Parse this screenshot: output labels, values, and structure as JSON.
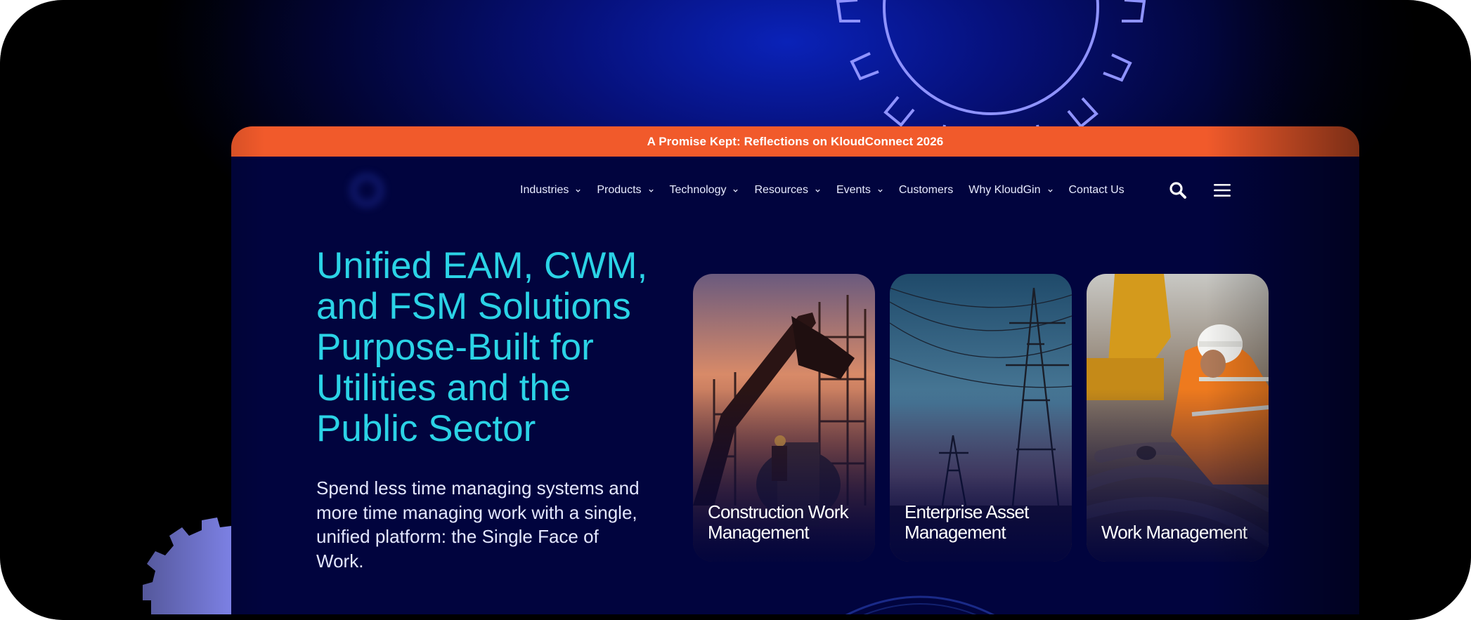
{
  "promo_banner": {
    "text": "A Promise Kept: Reflections on KloudConnect 2026"
  },
  "nav": {
    "items": [
      {
        "label": "Industries",
        "has_dropdown": true
      },
      {
        "label": "Products",
        "has_dropdown": true
      },
      {
        "label": "Technology",
        "has_dropdown": true
      },
      {
        "label": "Resources",
        "has_dropdown": true
      },
      {
        "label": "Events",
        "has_dropdown": true
      },
      {
        "label": "Customers",
        "has_dropdown": false
      },
      {
        "label": "Why KloudGin",
        "has_dropdown": true
      },
      {
        "label": "Contact Us",
        "has_dropdown": false
      }
    ],
    "search_icon": "search-icon",
    "menu_icon": "hamburger-menu-icon"
  },
  "hero": {
    "title": "Unified EAM, CWM, and FSM Solutions Purpose-Built for Utilities and the Public Sector",
    "description": "Spend less time managing systems and more time managing work with a single, unified platform: the Single Face of Work."
  },
  "cards": [
    {
      "label": "Construction Work Management",
      "image": "excavator-construction-site"
    },
    {
      "label": "Enterprise Asset Management",
      "image": "power-transmission-towers"
    },
    {
      "label": "Work Management",
      "image": "field-worker-pipes"
    }
  ],
  "colors": {
    "accent_orange": "#f15a2b",
    "title_cyan": "#2bd3e6",
    "site_background": "#01043e",
    "gear_lavender": "#8f93ff"
  }
}
